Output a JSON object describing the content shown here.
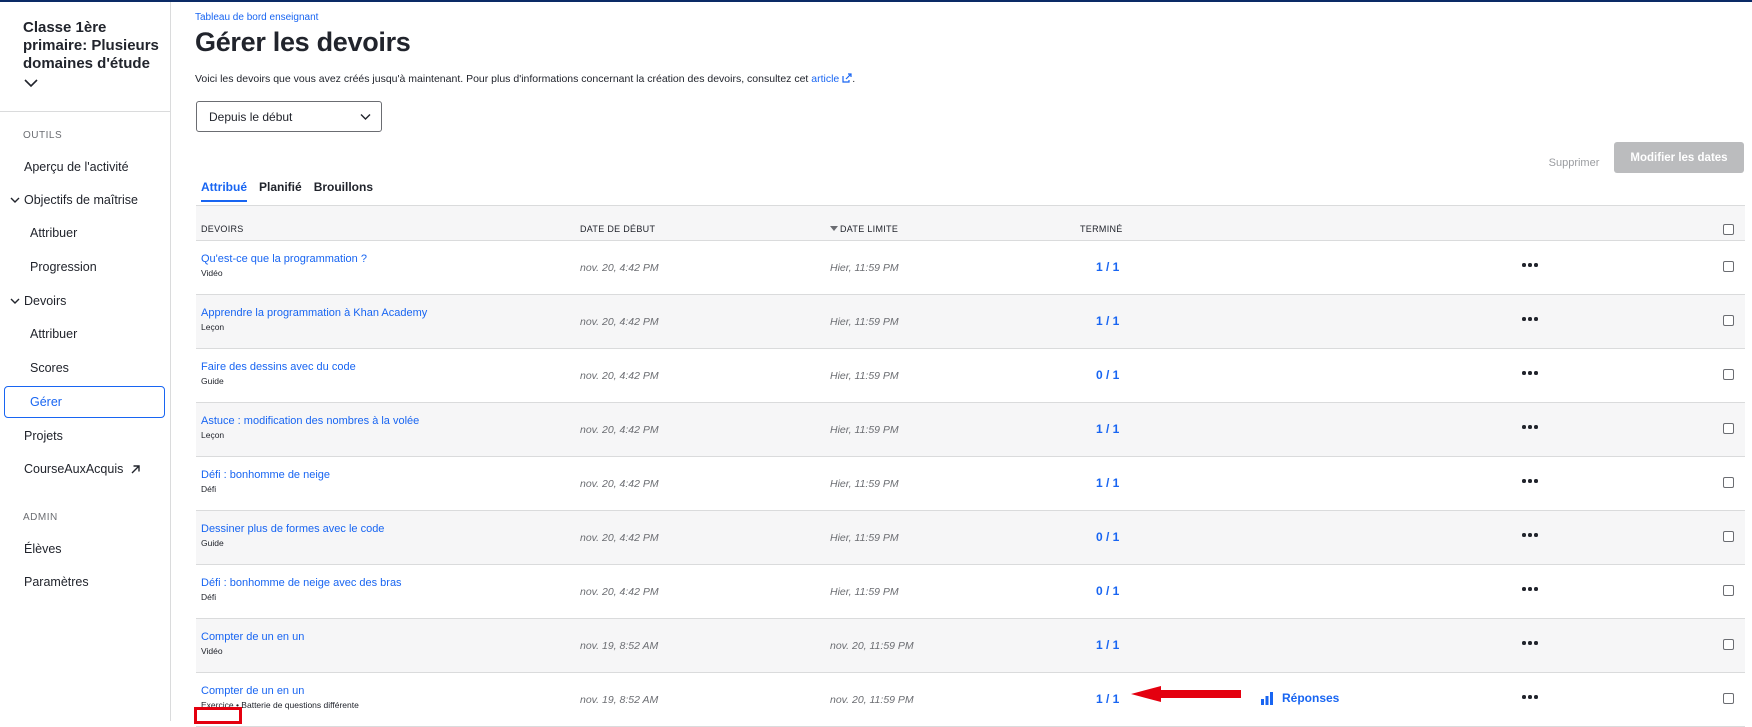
{
  "sidebar": {
    "class_title": "Classe 1ère primaire: Plusieurs domaines d'étude",
    "section_tools": "OUTILS",
    "item_activity": "Aperçu de l'activité",
    "item_mastery": "Objectifs de maîtrise",
    "item_mastery_assign": "Attribuer",
    "item_mastery_progress": "Progression",
    "item_assignments": "Devoirs",
    "item_assignments_assign": "Attribuer",
    "item_assignments_scores": "Scores",
    "item_assignments_manage": "Gérer",
    "item_projects": "Projets",
    "item_course": "CourseAuxAcquis",
    "section_admin": "ADMIN",
    "item_students": "Élèves",
    "item_settings": "Paramètres"
  },
  "header": {
    "breadcrumb": "Tableau de bord enseignant",
    "title": "Gérer les devoirs",
    "intro_text": "Voici les devoirs que vous avez créés jusqu'à maintenant. Pour plus d'informations concernant la création des devoirs, consultez cet",
    "intro_link": "article",
    "intro_end": "."
  },
  "filter": {
    "selected": "Depuis le début"
  },
  "actions": {
    "delete": "Supprimer",
    "edit_dates": "Modifier les dates"
  },
  "tabs": [
    "Attribué",
    "Planifié",
    "Brouillons"
  ],
  "table": {
    "columns": {
      "assignment": "DEVOIRS",
      "start": "DATE DE DÉBUT",
      "due": "DATE LIMITE",
      "done": "TERMINÉ"
    },
    "rows": [
      {
        "title": "Qu'est-ce que la programmation ?",
        "type": "Vidéo",
        "start": "nov. 20, 4:42 PM",
        "due": "Hier, 11:59 PM",
        "done": "1 / 1"
      },
      {
        "title": "Apprendre la programmation à Khan Academy",
        "type": "Leçon",
        "start": "nov. 20, 4:42 PM",
        "due": "Hier, 11:59 PM",
        "done": "1 / 1"
      },
      {
        "title": "Faire des dessins avec du code",
        "type": "Guide",
        "start": "nov. 20, 4:42 PM",
        "due": "Hier, 11:59 PM",
        "done": "0 / 1"
      },
      {
        "title": "Astuce : modification des nombres à la volée",
        "type": "Leçon",
        "start": "nov. 20, 4:42 PM",
        "due": "Hier, 11:59 PM",
        "done": "1 / 1"
      },
      {
        "title": "Défi : bonhomme de neige",
        "type": "Défi",
        "start": "nov. 20, 4:42 PM",
        "due": "Hier, 11:59 PM",
        "done": "1 / 1"
      },
      {
        "title": "Dessiner plus de formes avec le code",
        "type": "Guide",
        "start": "nov. 20, 4:42 PM",
        "due": "Hier, 11:59 PM",
        "done": "0 / 1"
      },
      {
        "title": "Défi : bonhomme de neige avec des bras",
        "type": "Défi",
        "start": "nov. 20, 4:42 PM",
        "due": "Hier, 11:59 PM",
        "done": "0 / 1"
      },
      {
        "title": "Compter de un en un",
        "type": "Vidéo",
        "start": "nov. 19, 8:52 AM",
        "due": "nov. 20, 11:59 PM",
        "done": "1 / 1"
      },
      {
        "title": "Compter de un en un",
        "type": "Exercice",
        "type_extra": "• Batterie de questions différente",
        "start": "nov. 19, 8:52 AM",
        "due": "nov. 20, 11:59 PM",
        "done": "1 / 1",
        "responses": "Réponses"
      }
    ]
  },
  "colors": {
    "accent": "#1865f2",
    "annotation": "#e4000f",
    "disabled_button": "#bbbcbe"
  }
}
